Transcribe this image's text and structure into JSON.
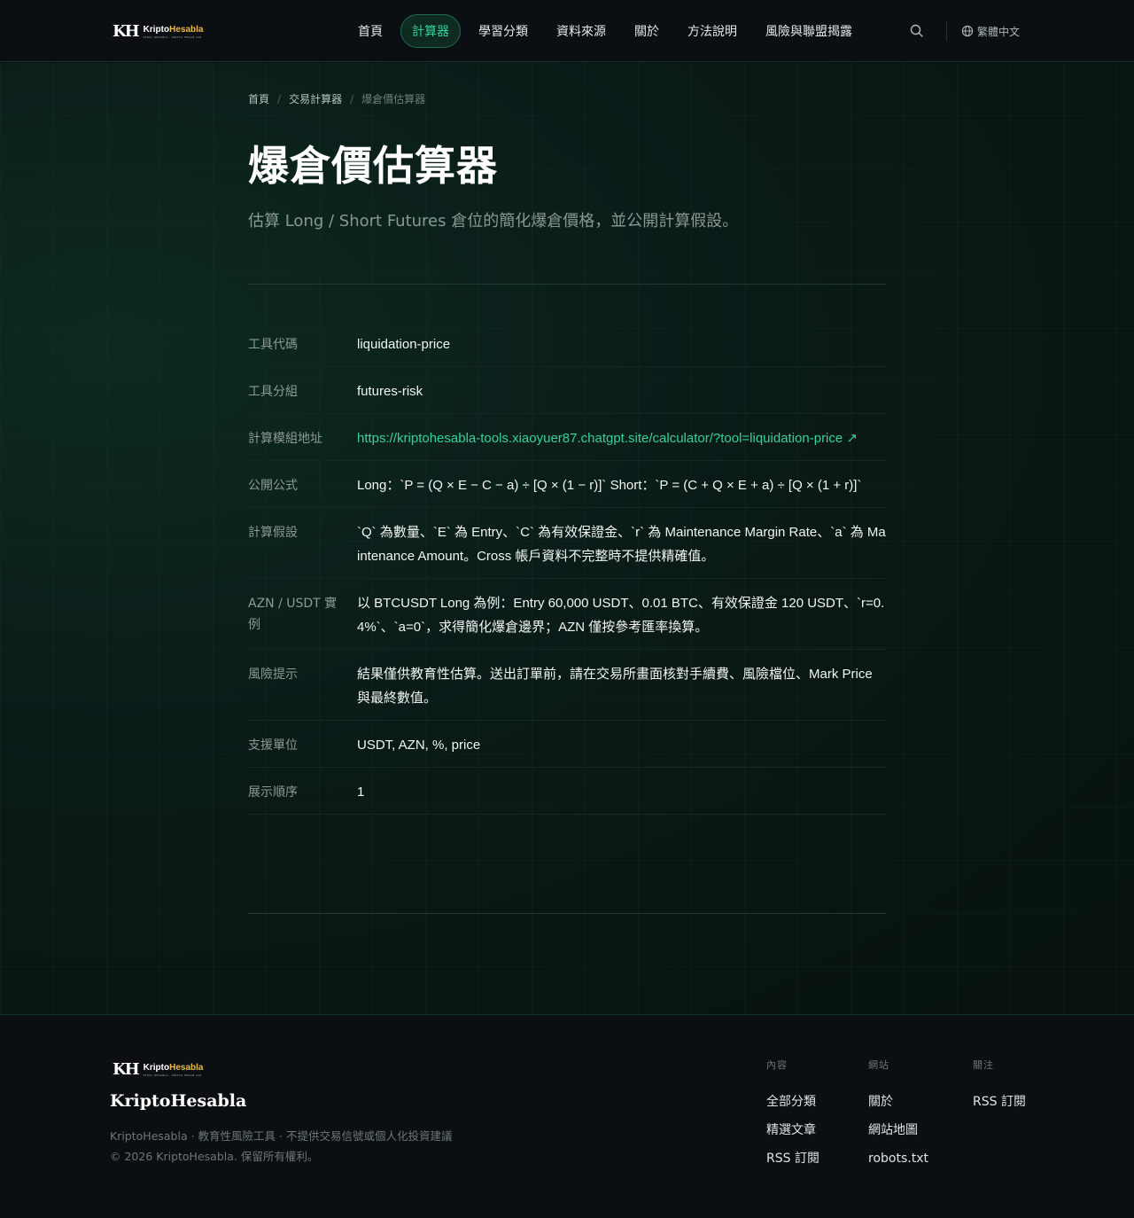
{
  "header": {
    "logo_mark": "KH",
    "logo_name_a": "Kripto",
    "logo_name_b": "Hesabla",
    "logo_tagline": "ETKİLİ HESABLA · KRİPTO HESAB LAR",
    "nav": [
      {
        "label": "首頁",
        "active": false
      },
      {
        "label": "計算器",
        "active": true
      },
      {
        "label": "學習分類",
        "active": false
      },
      {
        "label": "資料來源",
        "active": false
      },
      {
        "label": "關於",
        "active": false
      },
      {
        "label": "方法說明",
        "active": false
      },
      {
        "label": "風險與聯盟揭露",
        "active": false
      }
    ],
    "search_icon": "search-icon",
    "globe_icon": "globe-icon",
    "language": "繁體中文"
  },
  "breadcrumb": {
    "home": "首頁",
    "section": "交易計算器",
    "current": "爆倉價估算器",
    "separator": "/"
  },
  "page": {
    "title": "爆倉價估算器",
    "subtitle": "估算 Long / Short Futures 倉位的簡化爆倉價格，並公開計算假設。"
  },
  "details": [
    {
      "key": "工具代碼",
      "value": "liquidation-price",
      "link": false
    },
    {
      "key": "工具分組",
      "value": "futures-risk",
      "link": false
    },
    {
      "key": "計算模組地址",
      "value": "https://kriptohesabla-tools.xiaoyuer87.chatgpt.site/calculator/?tool=liquidation-price ↗",
      "link": true
    },
    {
      "key": "公開公式",
      "value": "Long：`P = (Q × E − C − a) ÷ [Q × (1 − r)]` Short：`P = (C + Q × E + a) ÷ [Q × (1 + r)]`",
      "link": false
    },
    {
      "key": "計算假設",
      "value": "`Q` 為數量、`E` 為 Entry、`C` 為有效保證金、`r` 為 Maintenance Margin Rate、`a` 為 Maintenance Amount。Cross 帳戶資料不完整時不提供精確值。",
      "link": false
    },
    {
      "key": "AZN / USDT 實例",
      "value": "以 BTCUSDT Long 為例：Entry 60,000 USDT、0.01 BTC、有效保證金 120 USDT、`r=0.4%`、`a=0`，求得簡化爆倉邊界；AZN 僅按參考匯率換算。",
      "link": false
    },
    {
      "key": "風險提示",
      "value": "結果僅供教育性估算。送出訂單前，請在交易所畫面核對手續費、風險檔位、Mark Price 與最終數值。",
      "link": false
    },
    {
      "key": "支援單位",
      "value": "USDT, AZN, %, price",
      "link": false
    },
    {
      "key": "展示順序",
      "value": "1",
      "link": false
    }
  ],
  "footer": {
    "name": "KriptoHesabla",
    "description": "KriptoHesabla · 教育性風險工具 · 不提供交易信號或個人化投資建議",
    "copyright": "© 2026 KriptoHesabla. 保留所有權利。",
    "columns": [
      {
        "heading": "內容",
        "links": [
          "全部分類",
          "精選文章",
          "RSS 訂閱"
        ]
      },
      {
        "heading": "網站",
        "links": [
          "關於",
          "網站地圖",
          "robots.txt"
        ]
      },
      {
        "heading": "關注",
        "links": [
          "RSS 訂閱"
        ]
      }
    ]
  },
  "colors": {
    "accent": "#34d399",
    "logo_gold": "#e9b949",
    "background": "#071211"
  }
}
